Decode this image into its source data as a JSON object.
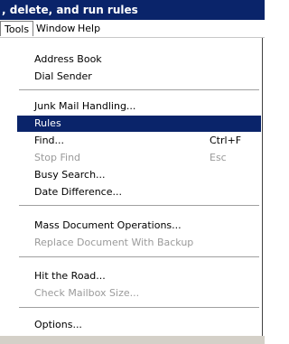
{
  "window": {
    "title": ", delete, and run rules"
  },
  "menubar": {
    "items": [
      "Tools",
      "Window",
      "Help"
    ]
  },
  "tools_menu": {
    "groups": [
      [
        {
          "label": "Address Book",
          "enabled": true
        },
        {
          "label": "Dial Sender",
          "enabled": true
        }
      ],
      [
        {
          "label": "Junk Mail Handling...",
          "enabled": true
        },
        {
          "label": "Rules",
          "enabled": true,
          "selected": true
        },
        {
          "label": "Find...",
          "shortcut": "Ctrl+F",
          "enabled": true
        },
        {
          "label": "Stop Find",
          "shortcut": "Esc",
          "enabled": false
        },
        {
          "label": "Busy Search...",
          "enabled": true
        },
        {
          "label": "Date Difference...",
          "enabled": true
        }
      ],
      [
        {
          "label": "Mass Document Operations...",
          "enabled": true
        },
        {
          "label": "Replace Document With Backup",
          "enabled": false
        }
      ],
      [
        {
          "label": "Hit the Road...",
          "enabled": true
        },
        {
          "label": "Check Mailbox Size...",
          "enabled": false
        }
      ],
      [
        {
          "label": "Options...",
          "enabled": true
        }
      ]
    ]
  },
  "colors": {
    "titlebar": "#0a246a",
    "selection": "#0a246a",
    "disabled_text": "#9a9a9a"
  }
}
